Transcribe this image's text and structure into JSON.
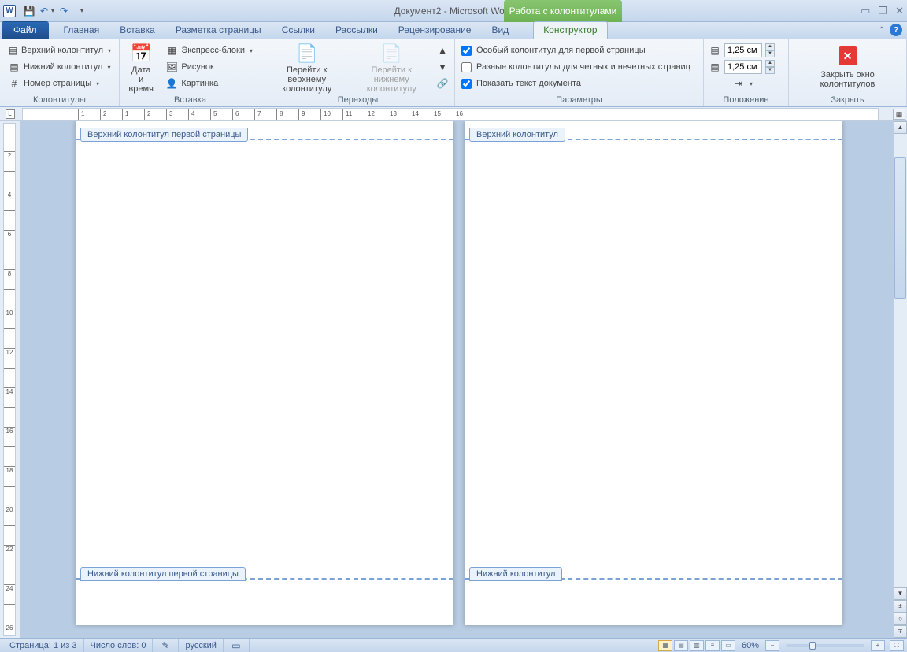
{
  "title": "Документ2 - Microsoft Word",
  "contextual_tab_label": "Работа с колонтитулами",
  "tabs": {
    "file": "Файл",
    "items": [
      "Главная",
      "Вставка",
      "Разметка страницы",
      "Ссылки",
      "Рассылки",
      "Рецензирование",
      "Вид"
    ],
    "constructor": "Конструктор"
  },
  "ribbon": {
    "headers_group": {
      "top": "Верхний колонтитул",
      "bottom": "Нижний колонтитул",
      "pagenum": "Номер страницы",
      "label": "Колонтитулы"
    },
    "datetime": {
      "line1": "Дата и",
      "line2": "время"
    },
    "insert_group": {
      "express": "Экспресс-блоки",
      "picture": "Рисунок",
      "clipart": "Картинка",
      "label": "Вставка"
    },
    "nav_group": {
      "go_top_l1": "Перейти к верхнему",
      "go_top_l2": "колонтитулу",
      "go_bot_l1": "Перейти к нижнему",
      "go_bot_l2": "колонтитулу",
      "label": "Переходы"
    },
    "options_group": {
      "first_page": "Особый колонтитул для первой страницы",
      "odd_even": "Разные колонтитулы для четных и нечетных страниц",
      "show_doc": "Показать текст документа",
      "label": "Параметры"
    },
    "position_group": {
      "top_val": "1,25 см",
      "bot_val": "1,25 см",
      "label": "Положение"
    },
    "close_group": {
      "line1": "Закрыть окно",
      "line2": "колонтитулов",
      "label": "Закрыть"
    }
  },
  "doc": {
    "page1_header_tag": "Верхний колонтитул первой страницы",
    "page2_header_tag": "Верхний колонтитул",
    "page1_footer_tag": "Нижний колонтитул первой страницы",
    "page2_footer_tag": "Нижний колонтитул"
  },
  "status": {
    "page": "Страница: 1 из 3",
    "words": "Число слов: 0",
    "lang": "русский",
    "zoom": "60%"
  },
  "ruler_nums": [
    "1",
    "2",
    "1",
    "2",
    "3",
    "4",
    "5",
    "6",
    "7",
    "8",
    "9",
    "10",
    "11",
    "12",
    "13",
    "14",
    "15",
    "16"
  ]
}
